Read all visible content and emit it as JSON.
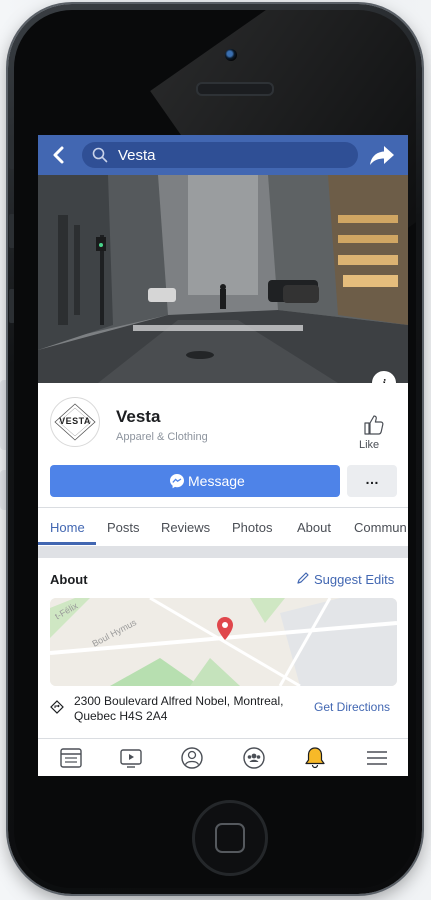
{
  "search": {
    "query": "Vesta"
  },
  "page": {
    "name": "Vesta",
    "category": "Apparel & Clothing",
    "logo_text": "VESTA",
    "like_label": "Like"
  },
  "actions": {
    "message_label": "Message",
    "more_label": "…"
  },
  "tabs": [
    {
      "label": "Home",
      "active": true
    },
    {
      "label": "Posts"
    },
    {
      "label": "Reviews"
    },
    {
      "label": "Photos"
    },
    {
      "label": "About"
    },
    {
      "label": "Commun"
    }
  ],
  "about": {
    "title": "About",
    "suggest_label": "Suggest Edits",
    "address": "2300 Boulevard Alfred Nobel, Montreal, Quebec H4S 2A4",
    "directions_label": "Get Directions",
    "map_labels": [
      "Boul Hymus",
      "t-Félix"
    ]
  },
  "bottom_nav": [
    {
      "icon": "news-feed-icon"
    },
    {
      "icon": "watch-icon"
    },
    {
      "icon": "profile-icon"
    },
    {
      "icon": "groups-icon"
    },
    {
      "icon": "notifications-bell-icon"
    },
    {
      "icon": "menu-icon"
    }
  ],
  "colors": {
    "brand_blue": "#4267b2",
    "message_blue": "#4e83e8",
    "bell_yellow": "#f7b928",
    "pin_red": "#e0474c"
  }
}
